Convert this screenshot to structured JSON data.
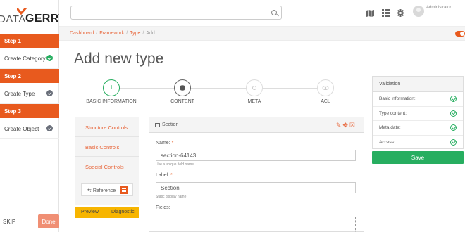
{
  "app": {
    "logo_left": "DATA",
    "logo_right": "GERRY"
  },
  "steps": [
    {
      "header": "Step 1",
      "label": "Create Category",
      "status": "complete"
    },
    {
      "header": "Step 2",
      "label": "Create Type",
      "status": "pending"
    },
    {
      "header": "Step 3",
      "label": "Create Object",
      "status": "pending"
    }
  ],
  "sidebar_footer": {
    "skip": "SKIP",
    "done": "Done"
  },
  "topbar": {
    "search_placeholder": "",
    "icons": [
      "map-icon",
      "grid-icon",
      "gear-icon"
    ],
    "user": "Administrator"
  },
  "breadcrumb": {
    "items": [
      "Dashboard",
      "Framework",
      "Type"
    ],
    "current": "Add"
  },
  "page_title": "Add new type",
  "wizard": {
    "steps": [
      {
        "label": "BASIC INFORMATION",
        "icon": "info-icon",
        "state": "done"
      },
      {
        "label": "CONTENT",
        "icon": "database-icon",
        "state": "active"
      },
      {
        "label": "META",
        "icon": "meta-icon",
        "state": "todo"
      },
      {
        "label": "ACL",
        "icon": "acl-icon",
        "state": "todo"
      }
    ],
    "done_glyph": "i"
  },
  "validation": {
    "title": "Validation",
    "items": [
      "Basic information:",
      "Type content:",
      "Meta data:",
      "Access:"
    ],
    "save_label": "Save"
  },
  "controls": {
    "items": [
      "Structure Controls",
      "Basic Controls",
      "Special Controls"
    ],
    "reference_label": "Reference",
    "preview_label": "Preview",
    "diagnostic_label": "Diagnostic"
  },
  "section": {
    "title": "Section",
    "name_label": "Name:",
    "name_value": "section-64143",
    "name_help": "Use a unique field name",
    "label_label": "Label:",
    "label_value": "Section",
    "label_help": "Static display name",
    "fields_label": "Fields:",
    "required_mark": "*"
  },
  "colors": {
    "accent": "#e85a1e",
    "success": "#27ae60",
    "warning": "#f7b500"
  }
}
